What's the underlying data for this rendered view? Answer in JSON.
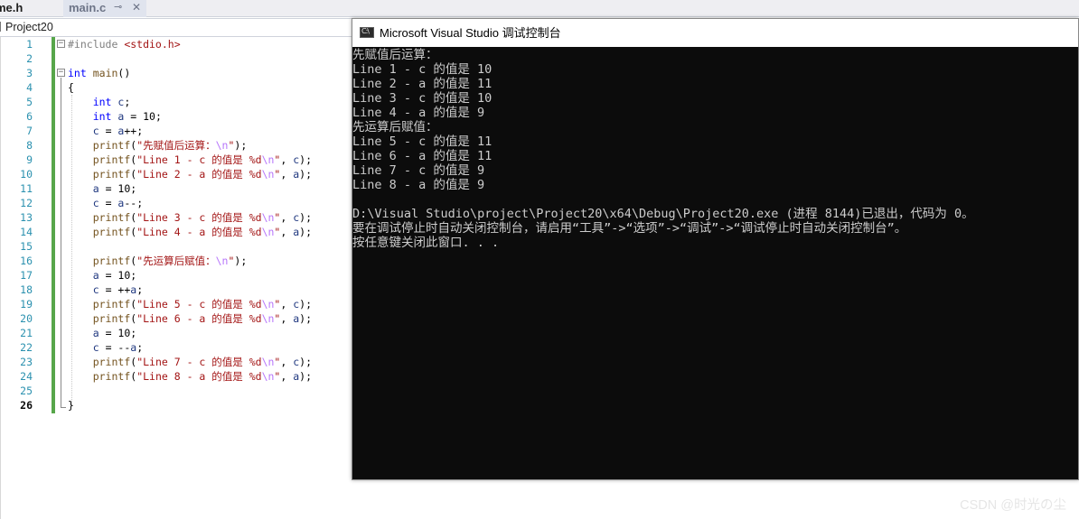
{
  "tabs": [
    {
      "label": "me.h",
      "active": false
    },
    {
      "label": "main.c",
      "active": true,
      "pin_icon": "pin-icon",
      "close_icon": "close-icon"
    }
  ],
  "nav": {
    "project": "Project20"
  },
  "editor": {
    "current_line": 26,
    "line_numbers": [
      "1",
      "2",
      "3",
      "4",
      "5",
      "6",
      "7",
      "8",
      "9",
      "10",
      "11",
      "12",
      "13",
      "14",
      "15",
      "16",
      "17",
      "18",
      "19",
      "20",
      "21",
      "22",
      "23",
      "24",
      "25",
      "26"
    ],
    "code_lines": [
      [
        {
          "t": "#include ",
          "c": "pp"
        },
        {
          "t": "<stdio.h>",
          "c": "inc"
        }
      ],
      [],
      [
        {
          "t": "int",
          "c": "kw"
        },
        {
          "t": " ",
          "c": ""
        },
        {
          "t": "main",
          "c": "fn"
        },
        {
          "t": "()",
          "c": ""
        }
      ],
      [
        {
          "t": "{",
          "c": ""
        }
      ],
      [
        {
          "t": "    ",
          "c": ""
        },
        {
          "t": "int",
          "c": "kw"
        },
        {
          "t": " ",
          "c": ""
        },
        {
          "t": "c",
          "c": "var"
        },
        {
          "t": ";",
          "c": ""
        }
      ],
      [
        {
          "t": "    ",
          "c": ""
        },
        {
          "t": "int",
          "c": "kw"
        },
        {
          "t": " ",
          "c": ""
        },
        {
          "t": "a",
          "c": "var"
        },
        {
          "t": " = 10;",
          "c": ""
        }
      ],
      [
        {
          "t": "    ",
          "c": ""
        },
        {
          "t": "c",
          "c": "var"
        },
        {
          "t": " = ",
          "c": ""
        },
        {
          "t": "a",
          "c": "var"
        },
        {
          "t": "++;",
          "c": ""
        }
      ],
      [
        {
          "t": "    ",
          "c": ""
        },
        {
          "t": "printf",
          "c": "fn"
        },
        {
          "t": "(",
          "c": ""
        },
        {
          "t": "\"先赋值后运算：",
          "c": "str"
        },
        {
          "t": "\\n",
          "c": "esc"
        },
        {
          "t": "\"",
          "c": "str"
        },
        {
          "t": ");",
          "c": ""
        }
      ],
      [
        {
          "t": "    ",
          "c": ""
        },
        {
          "t": "printf",
          "c": "fn"
        },
        {
          "t": "(",
          "c": ""
        },
        {
          "t": "\"Line 1 - c 的值是 ",
          "c": "str"
        },
        {
          "t": "%d",
          "c": "pct"
        },
        {
          "t": "\\n",
          "c": "esc"
        },
        {
          "t": "\"",
          "c": "str"
        },
        {
          "t": ", ",
          "c": ""
        },
        {
          "t": "c",
          "c": "var"
        },
        {
          "t": ");",
          "c": ""
        }
      ],
      [
        {
          "t": "    ",
          "c": ""
        },
        {
          "t": "printf",
          "c": "fn"
        },
        {
          "t": "(",
          "c": ""
        },
        {
          "t": "\"Line 2 - a 的值是 ",
          "c": "str"
        },
        {
          "t": "%d",
          "c": "pct"
        },
        {
          "t": "\\n",
          "c": "esc"
        },
        {
          "t": "\"",
          "c": "str"
        },
        {
          "t": ", ",
          "c": ""
        },
        {
          "t": "a",
          "c": "var"
        },
        {
          "t": ");",
          "c": ""
        }
      ],
      [
        {
          "t": "    ",
          "c": ""
        },
        {
          "t": "a",
          "c": "var"
        },
        {
          "t": " = 10;",
          "c": ""
        }
      ],
      [
        {
          "t": "    ",
          "c": ""
        },
        {
          "t": "c",
          "c": "var"
        },
        {
          "t": " = ",
          "c": ""
        },
        {
          "t": "a",
          "c": "var"
        },
        {
          "t": "--;",
          "c": ""
        }
      ],
      [
        {
          "t": "    ",
          "c": ""
        },
        {
          "t": "printf",
          "c": "fn"
        },
        {
          "t": "(",
          "c": ""
        },
        {
          "t": "\"Line 3 - c 的值是 ",
          "c": "str"
        },
        {
          "t": "%d",
          "c": "pct"
        },
        {
          "t": "\\n",
          "c": "esc"
        },
        {
          "t": "\"",
          "c": "str"
        },
        {
          "t": ", ",
          "c": ""
        },
        {
          "t": "c",
          "c": "var"
        },
        {
          "t": ");",
          "c": ""
        }
      ],
      [
        {
          "t": "    ",
          "c": ""
        },
        {
          "t": "printf",
          "c": "fn"
        },
        {
          "t": "(",
          "c": ""
        },
        {
          "t": "\"Line 4 - a 的值是 ",
          "c": "str"
        },
        {
          "t": "%d",
          "c": "pct"
        },
        {
          "t": "\\n",
          "c": "esc"
        },
        {
          "t": "\"",
          "c": "str"
        },
        {
          "t": ", ",
          "c": ""
        },
        {
          "t": "a",
          "c": "var"
        },
        {
          "t": ");",
          "c": ""
        }
      ],
      [],
      [
        {
          "t": "    ",
          "c": ""
        },
        {
          "t": "printf",
          "c": "fn"
        },
        {
          "t": "(",
          "c": ""
        },
        {
          "t": "\"先运算后赋值：",
          "c": "str"
        },
        {
          "t": "\\n",
          "c": "esc"
        },
        {
          "t": "\"",
          "c": "str"
        },
        {
          "t": ");",
          "c": ""
        }
      ],
      [
        {
          "t": "    ",
          "c": ""
        },
        {
          "t": "a",
          "c": "var"
        },
        {
          "t": " = 10;",
          "c": ""
        }
      ],
      [
        {
          "t": "    ",
          "c": ""
        },
        {
          "t": "c",
          "c": "var"
        },
        {
          "t": " = ++",
          "c": ""
        },
        {
          "t": "a",
          "c": "var"
        },
        {
          "t": ";",
          "c": ""
        }
      ],
      [
        {
          "t": "    ",
          "c": ""
        },
        {
          "t": "printf",
          "c": "fn"
        },
        {
          "t": "(",
          "c": ""
        },
        {
          "t": "\"Line 5 - c 的值是 ",
          "c": "str"
        },
        {
          "t": "%d",
          "c": "pct"
        },
        {
          "t": "\\n",
          "c": "esc"
        },
        {
          "t": "\"",
          "c": "str"
        },
        {
          "t": ", ",
          "c": ""
        },
        {
          "t": "c",
          "c": "var"
        },
        {
          "t": ");",
          "c": ""
        }
      ],
      [
        {
          "t": "    ",
          "c": ""
        },
        {
          "t": "printf",
          "c": "fn"
        },
        {
          "t": "(",
          "c": ""
        },
        {
          "t": "\"Line 6 - a 的值是 ",
          "c": "str"
        },
        {
          "t": "%d",
          "c": "pct"
        },
        {
          "t": "\\n",
          "c": "esc"
        },
        {
          "t": "\"",
          "c": "str"
        },
        {
          "t": ", ",
          "c": ""
        },
        {
          "t": "a",
          "c": "var"
        },
        {
          "t": ");",
          "c": ""
        }
      ],
      [
        {
          "t": "    ",
          "c": ""
        },
        {
          "t": "a",
          "c": "var"
        },
        {
          "t": " = 10;",
          "c": ""
        }
      ],
      [
        {
          "t": "    ",
          "c": ""
        },
        {
          "t": "c",
          "c": "var"
        },
        {
          "t": " = --",
          "c": ""
        },
        {
          "t": "a",
          "c": "var"
        },
        {
          "t": ";",
          "c": ""
        }
      ],
      [
        {
          "t": "    ",
          "c": ""
        },
        {
          "t": "printf",
          "c": "fn"
        },
        {
          "t": "(",
          "c": ""
        },
        {
          "t": "\"Line 7 - c 的值是 ",
          "c": "str"
        },
        {
          "t": "%d",
          "c": "pct"
        },
        {
          "t": "\\n",
          "c": "esc"
        },
        {
          "t": "\"",
          "c": "str"
        },
        {
          "t": ", ",
          "c": ""
        },
        {
          "t": "c",
          "c": "var"
        },
        {
          "t": ");",
          "c": ""
        }
      ],
      [
        {
          "t": "    ",
          "c": ""
        },
        {
          "t": "printf",
          "c": "fn"
        },
        {
          "t": "(",
          "c": ""
        },
        {
          "t": "\"Line 8 - a 的值是 ",
          "c": "str"
        },
        {
          "t": "%d",
          "c": "pct"
        },
        {
          "t": "\\n",
          "c": "esc"
        },
        {
          "t": "\"",
          "c": "str"
        },
        {
          "t": ", ",
          "c": ""
        },
        {
          "t": "a",
          "c": "var"
        },
        {
          "t": ");",
          "c": ""
        }
      ],
      [],
      [
        {
          "t": "}",
          "c": ""
        }
      ]
    ]
  },
  "console": {
    "title": "Microsoft Visual Studio 调试控制台",
    "icon_label": "C:\\",
    "lines": [
      "先赋值后运算：",
      "Line 1 - c 的值是 10",
      "Line 2 - a 的值是 11",
      "Line 3 - c 的值是 10",
      "Line 4 - a 的值是 9",
      "先运算后赋值：",
      "Line 5 - c 的值是 11",
      "Line 6 - a 的值是 11",
      "Line 7 - c 的值是 9",
      "Line 8 - a 的值是 9",
      "",
      "D:\\Visual Studio\\project\\Project20\\x64\\Debug\\Project20.exe (进程 8144)已退出，代码为 0。",
      "要在调试停止时自动关闭控制台，请启用“工具”->“选项”->“调试”->“调试停止时自动关闭控制台”。",
      "按任意键关闭此窗口. . ."
    ]
  },
  "watermark": "CSDN @时光の尘",
  "colors": {
    "keyword": "#0000ff",
    "string": "#a31515",
    "function": "#74531f",
    "variable": "#1f377f",
    "escape": "#b776fb",
    "line_number": "#2b91af",
    "change_bar": "#57a64a",
    "console_bg": "#0c0c0c",
    "console_fg": "#cccccc"
  }
}
